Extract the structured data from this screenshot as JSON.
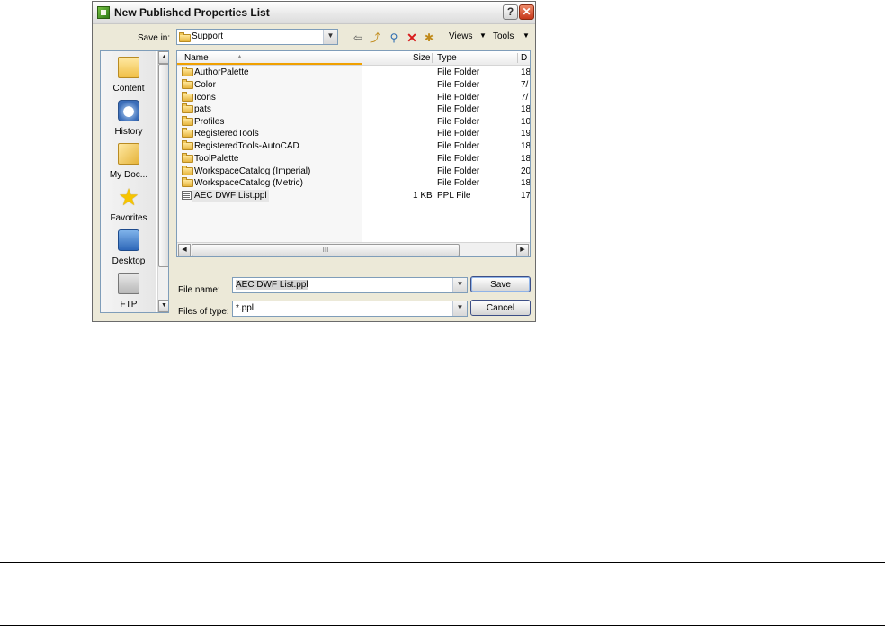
{
  "dialog": {
    "title": "New Published Properties List",
    "help_glyph": "?",
    "close_glyph": "✕"
  },
  "toolbar": {
    "save_in_label": "Save in:",
    "save_in_value": "Support",
    "views_label": "Views",
    "tools_label": "Tools"
  },
  "places": [
    {
      "label": "Content",
      "icon": "content-folder-icon"
    },
    {
      "label": "History",
      "icon": "history-icon"
    },
    {
      "label": "My Doc...",
      "icon": "my-documents-icon"
    },
    {
      "label": "Favorites",
      "icon": "favorites-star-icon"
    },
    {
      "label": "Desktop",
      "icon": "desktop-icon"
    },
    {
      "label": "FTP",
      "icon": "ftp-icon"
    }
  ],
  "columns": {
    "name": "Name",
    "size": "Size",
    "type": "Type",
    "date": "D"
  },
  "files": [
    {
      "name": "AuthorPalette",
      "size": "",
      "type": "File Folder",
      "date": "18",
      "kind": "folder"
    },
    {
      "name": "Color",
      "size": "",
      "type": "File Folder",
      "date": "7/",
      "kind": "folder"
    },
    {
      "name": "Icons",
      "size": "",
      "type": "File Folder",
      "date": "7/",
      "kind": "folder"
    },
    {
      "name": "pats",
      "size": "",
      "type": "File Folder",
      "date": "18",
      "kind": "folder"
    },
    {
      "name": "Profiles",
      "size": "",
      "type": "File Folder",
      "date": "10",
      "kind": "folder"
    },
    {
      "name": "RegisteredTools",
      "size": "",
      "type": "File Folder",
      "date": "19",
      "kind": "folder"
    },
    {
      "name": "RegisteredTools-AutoCAD",
      "size": "",
      "type": "File Folder",
      "date": "18",
      "kind": "folder"
    },
    {
      "name": "ToolPalette",
      "size": "",
      "type": "File Folder",
      "date": "18",
      "kind": "folder"
    },
    {
      "name": "WorkspaceCatalog (Imperial)",
      "size": "",
      "type": "File Folder",
      "date": "20",
      "kind": "folder"
    },
    {
      "name": "WorkspaceCatalog (Metric)",
      "size": "",
      "type": "File Folder",
      "date": "18",
      "kind": "folder"
    },
    {
      "name": "AEC DWF List.ppl",
      "size": "1 KB",
      "type": "PPL File",
      "date": "17",
      "kind": "ppl"
    }
  ],
  "form": {
    "file_name_label": "File name:",
    "file_name_value": "AEC DWF List.ppl",
    "file_type_label": "Files of type:",
    "file_type_value": "*.ppl",
    "save_label": "Save",
    "cancel_label": "Cancel"
  },
  "hscroll_grip": "III"
}
